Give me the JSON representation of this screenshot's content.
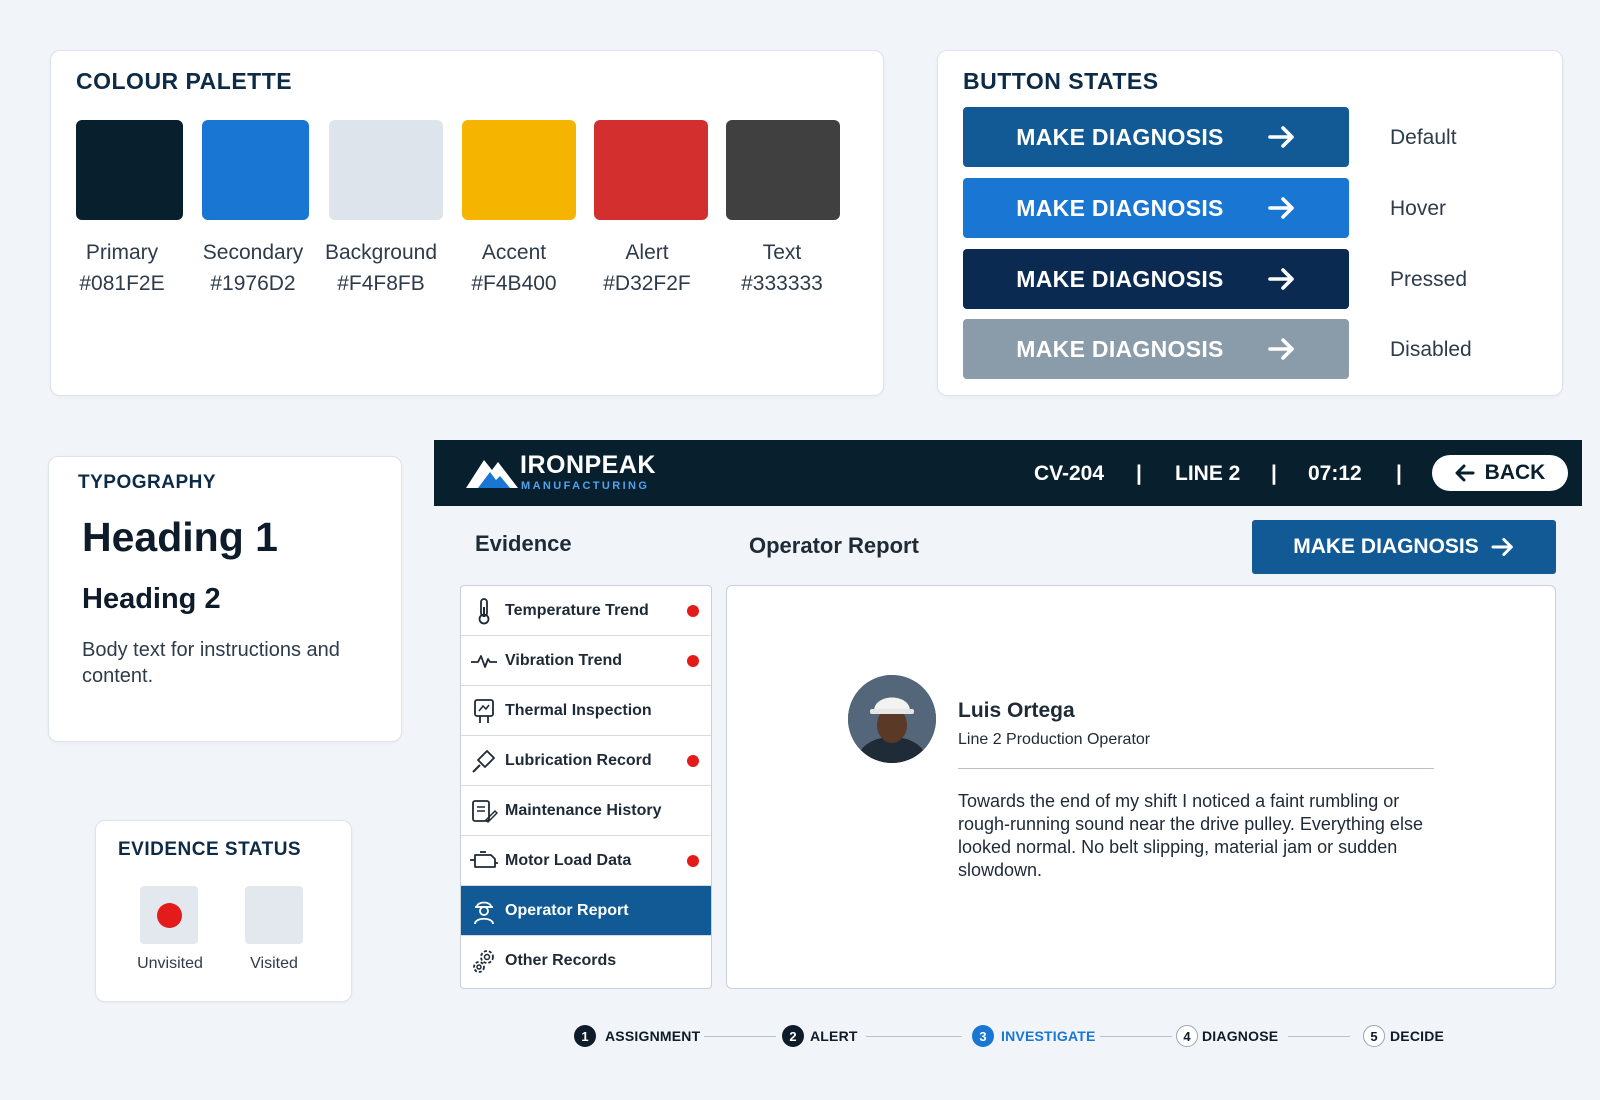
{
  "palette": {
    "title": "COLOUR PALETTE",
    "swatches": [
      {
        "name": "Primary",
        "hex": "#081F2E"
      },
      {
        "name": "Secondary",
        "hex": "#1976D2"
      },
      {
        "name": "Background",
        "hex": "#F4F8FB"
      },
      {
        "name": "Accent",
        "hex": "#F4B400"
      },
      {
        "name": "Alert",
        "hex": "#D32F2F"
      },
      {
        "name": "Text",
        "hex": "#333333"
      }
    ]
  },
  "button_states": {
    "title": "BUTTON STATES",
    "button_label": "MAKE DIAGNOSIS",
    "states": [
      {
        "label": "Default",
        "color": "#115A96"
      },
      {
        "label": "Hover",
        "color": "#1976D2"
      },
      {
        "label": "Pressed",
        "color": "#0A2A52"
      },
      {
        "label": "Disabled",
        "color": "#8A9BAA"
      }
    ]
  },
  "typography": {
    "title": "TYPOGRAPHY",
    "heading1": "Heading 1",
    "heading2": "Heading 2",
    "body": "Body text for instructions and content."
  },
  "evidence_status": {
    "title": "EVIDENCE STATUS",
    "unvisited": "Unvisited",
    "visited": "Visited"
  },
  "header": {
    "brand": "IRONPEAK",
    "brand_sub": "MANUFACTURING",
    "asset": "CV-204",
    "line": "LINE 2",
    "time": "07:12",
    "separator": "|",
    "back_label": "BACK"
  },
  "main": {
    "evidence_heading": "Evidence",
    "report_heading": "Operator Report",
    "diagnosis_button": "MAKE DIAGNOSIS"
  },
  "evidence_items": [
    {
      "label": "Temperature Trend",
      "icon": "thermometer-icon",
      "unvisited": true
    },
    {
      "label": "Vibration Trend",
      "icon": "pulse-icon",
      "unvisited": true
    },
    {
      "label": "Thermal Inspection",
      "icon": "thermal-camera-icon",
      "unvisited": false
    },
    {
      "label": "Lubrication Record",
      "icon": "grease-gun-icon",
      "unvisited": true
    },
    {
      "label": "Maintenance History",
      "icon": "clipboard-edit-icon",
      "unvisited": false
    },
    {
      "label": "Motor Load Data",
      "icon": "motor-icon",
      "unvisited": true
    },
    {
      "label": "Operator Report",
      "icon": "operator-icon",
      "unvisited": false,
      "active": true
    },
    {
      "label": "Other Records",
      "icon": "gears-icon",
      "unvisited": false
    }
  ],
  "report": {
    "name": "Luis Ortega",
    "role": "Line 2 Production Operator",
    "text": "Towards the end of my shift I noticed a faint rumbling or rough-running sound near the drive pulley. Everything else looked normal. No belt slipping, material jam or sudden slowdown."
  },
  "stepper": [
    {
      "num": "1",
      "label": "ASSIGNMENT",
      "state": "done"
    },
    {
      "num": "2",
      "label": "ALERT",
      "state": "done"
    },
    {
      "num": "3",
      "label": "INVESTIGATE",
      "state": "current"
    },
    {
      "num": "4",
      "label": "DIAGNOSE",
      "state": "todo"
    },
    {
      "num": "5",
      "label": "DECIDE",
      "state": "todo"
    }
  ]
}
